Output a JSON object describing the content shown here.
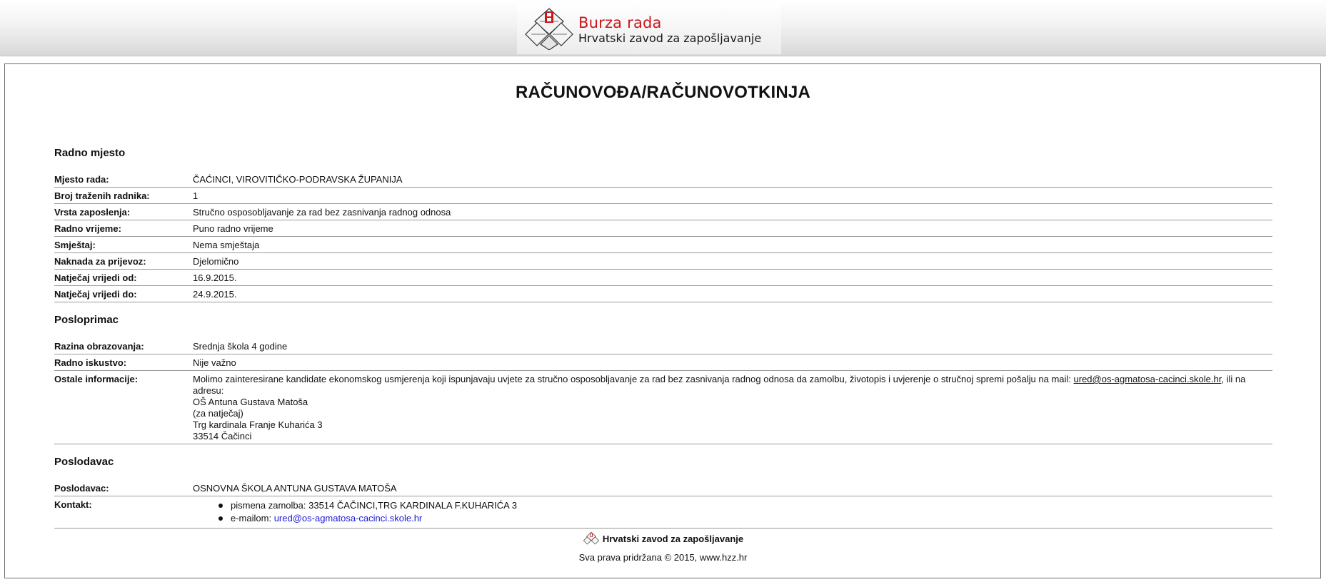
{
  "header": {
    "brand_title": "Burza rada",
    "brand_subtitle": "Hrvatski zavod za zapošljavanje"
  },
  "page_title": "RAČUNOVOĐA/RAČUNOVOTKINJA",
  "sections": {
    "radno_mjesto": {
      "title": "Radno mjesto",
      "rows": [
        {
          "label": "Mjesto rada:",
          "value": "ČAĆINCI, VIROVITIČKO-PODRAVSKA ŽUPANIJA"
        },
        {
          "label": "Broj traženih radnika:",
          "value": "1"
        },
        {
          "label": "Vrsta zaposlenja:",
          "value": "Stručno osposobljavanje za rad bez zasnivanja radnog odnosa"
        },
        {
          "label": "Radno vrijeme:",
          "value": "Puno radno vrijeme"
        },
        {
          "label": "Smještaj:",
          "value": "Nema smještaja"
        },
        {
          "label": "Naknada za prijevoz:",
          "value": "Djelomično"
        },
        {
          "label": "Natječaj vrijedi od:",
          "value": "16.9.2015."
        },
        {
          "label": "Natječaj vrijedi do:",
          "value": "24.9.2015."
        }
      ]
    },
    "posloprimac": {
      "title": "Posloprimac",
      "rows": [
        {
          "label": "Razina obrazovanja:",
          "value": "Srednja škola 4 godine"
        },
        {
          "label": "Radno iskustvo:",
          "value": "Nije važno"
        }
      ],
      "other": {
        "label": "Ostale informacije:",
        "text_before": "Molimo zainteresirane kandidate ekonomskog usmjerenja koji ispunjavaju uvjete za stručno osposobljavanje za rad bez zasnivanja radnog odnosa da zamolbu, životopis i uvjerenje o stručnoj spremi pošalju na mail: ",
        "email": "ured@os-agmatosa-cacinci.skole.hr",
        "text_after": ", ili na adresu:",
        "address_lines": [
          "OŠ Antuna Gustava Matoša",
          "(za natječaj)",
          "Trg kardinala Franje Kuharića 3",
          "33514 Čačinci"
        ]
      }
    },
    "poslodavac": {
      "title": "Poslodavac",
      "employer_label": "Poslodavac:",
      "employer_value": "OSNOVNA ŠKOLA ANTUNA GUSTAVA MATOŠA",
      "contact_label": "Kontakt:",
      "contact_letter": "pismena zamolba: 33514 ČAČINCI,TRG KARDINALA F.KUHARIĆA 3",
      "contact_email_prefix": "e-mailom: ",
      "contact_email": "ured@os-agmatosa-cacinci.skole.hr"
    }
  },
  "footer": {
    "org": "Hrvatski zavod za zapošljavanje",
    "copyright": "Sva prava pridržana © 2015, www.hzz.hr"
  },
  "colors": {
    "brand_red": "#c8181f",
    "link_blue": "#1a1ad8"
  }
}
